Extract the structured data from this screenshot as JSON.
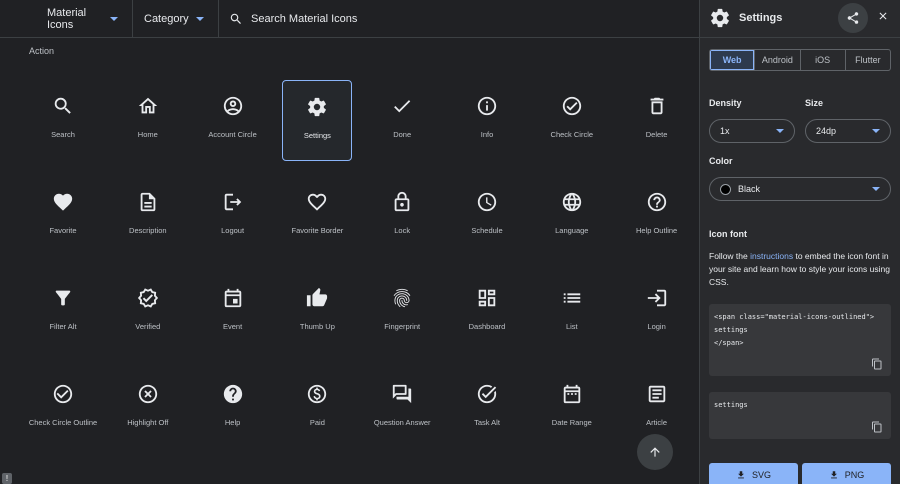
{
  "topbar": {
    "library_select": "Material Icons",
    "category_select": "Category",
    "search_placeholder": "Search Material Icons"
  },
  "section": {
    "title": "Action"
  },
  "icons": [
    {
      "label": "Search",
      "icon": "search-icon"
    },
    {
      "label": "Home",
      "icon": "home-icon"
    },
    {
      "label": "Account Circle",
      "icon": "account-circle-icon"
    },
    {
      "label": "Settings",
      "icon": "settings-icon",
      "selected": true
    },
    {
      "label": "Done",
      "icon": "done-icon"
    },
    {
      "label": "Info",
      "icon": "info-icon"
    },
    {
      "label": "Check Circle",
      "icon": "check-circle-icon"
    },
    {
      "label": "Delete",
      "icon": "delete-icon"
    },
    {
      "label": "Favorite",
      "icon": "favorite-icon"
    },
    {
      "label": "Description",
      "icon": "description-icon"
    },
    {
      "label": "Logout",
      "icon": "logout-icon"
    },
    {
      "label": "Favorite Border",
      "icon": "favorite-border-icon"
    },
    {
      "label": "Lock",
      "icon": "lock-icon"
    },
    {
      "label": "Schedule",
      "icon": "schedule-icon"
    },
    {
      "label": "Language",
      "icon": "language-icon"
    },
    {
      "label": "Help Outline",
      "icon": "help-outline-icon"
    },
    {
      "label": "Filter Alt",
      "icon": "filter-alt-icon"
    },
    {
      "label": "Verified",
      "icon": "verified-icon"
    },
    {
      "label": "Event",
      "icon": "event-icon"
    },
    {
      "label": "Thumb Up",
      "icon": "thumb-up-icon"
    },
    {
      "label": "Fingerprint",
      "icon": "fingerprint-icon"
    },
    {
      "label": "Dashboard",
      "icon": "dashboard-icon"
    },
    {
      "label": "List",
      "icon": "list-icon"
    },
    {
      "label": "Login",
      "icon": "login-icon"
    },
    {
      "label": "Check Circle Outline",
      "icon": "check-circle-outline-icon"
    },
    {
      "label": "Highlight Off",
      "icon": "highlight-off-icon"
    },
    {
      "label": "Help",
      "icon": "help-icon"
    },
    {
      "label": "Paid",
      "icon": "paid-icon"
    },
    {
      "label": "Question Answer",
      "icon": "question-answer-icon"
    },
    {
      "label": "Task Alt",
      "icon": "task-alt-icon"
    },
    {
      "label": "Date Range",
      "icon": "date-range-icon"
    },
    {
      "label": "Article",
      "icon": "article-icon"
    }
  ],
  "panel": {
    "title": "Settings",
    "platform_tabs": [
      "Web",
      "Android",
      "iOS",
      "Flutter"
    ],
    "active_tab": "Web",
    "density_label": "Density",
    "density_value": "1x",
    "size_label": "Size",
    "size_value": "24dp",
    "color_label": "Color",
    "color_value": "Black",
    "color_hex": "#000000",
    "icon_font_title": "Icon font",
    "icon_font_text_pre": "Follow the ",
    "icon_font_link": "instructions",
    "icon_font_text_post": " to embed the icon font in your site and learn how to style your icons using CSS.",
    "code_line1": "<span class=\"material-icons-outlined\">",
    "code_line2": "settings",
    "code_line3": "</span>",
    "code2": "settings",
    "download_svg": "SVG",
    "download_png": "PNG"
  },
  "colors": {
    "accent": "#8ab4f8",
    "background": "#202124",
    "panel": "#292a2d"
  }
}
